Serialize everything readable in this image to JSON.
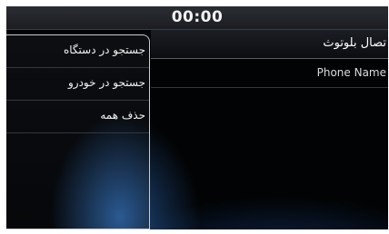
{
  "status_bar": {
    "clock": "00:00"
  },
  "menu": {
    "items": [
      {
        "label": "جستجو در دستگاه"
      },
      {
        "label": "جستجو در خودرو"
      },
      {
        "label": "حذف همه"
      }
    ]
  },
  "bluetooth": {
    "title": "تصال بلوتوث",
    "devices": [
      {
        "name": "Phone Name"
      }
    ]
  }
}
